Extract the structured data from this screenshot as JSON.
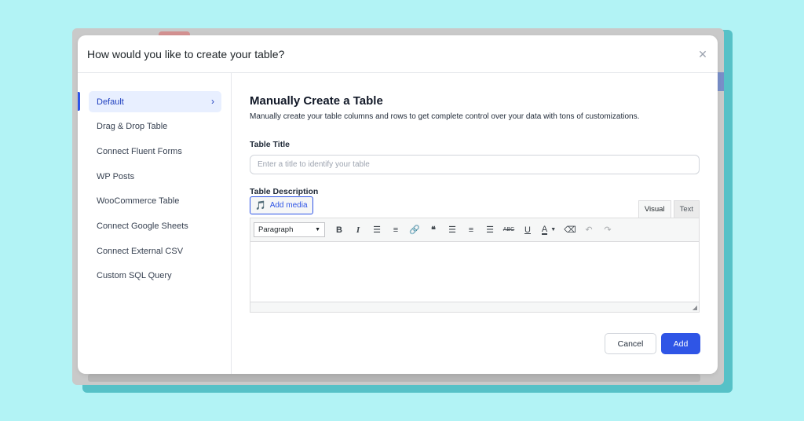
{
  "modal": {
    "title": "How would you like to create your table?",
    "close_icon": "close-icon"
  },
  "sidebar": {
    "items": [
      {
        "label": "Default",
        "active": true
      },
      {
        "label": "Drag & Drop Table"
      },
      {
        "label": "Connect Fluent Forms"
      },
      {
        "label": "WP Posts"
      },
      {
        "label": "WooCommerce Table"
      },
      {
        "label": "Connect Google Sheets"
      },
      {
        "label": "Connect External CSV"
      },
      {
        "label": "Custom SQL Query"
      }
    ]
  },
  "main": {
    "heading": "Manually Create a Table",
    "subtitle": "Manually create your table columns and rows to get complete control over your data with tons of customizations.",
    "title_field": {
      "label": "Table Title",
      "placeholder": "Enter a title to identify your table",
      "value": ""
    },
    "description_field": {
      "label": "Table Description"
    },
    "add_media_label": "Add media",
    "editor_tabs": {
      "visual": "Visual",
      "text": "Text"
    },
    "format_select": "Paragraph"
  },
  "actions": {
    "cancel": "Cancel",
    "add": "Add"
  },
  "colors": {
    "accent": "#2f55e6",
    "background": "#b2f3f5",
    "active_item_bg": "#e8efff"
  }
}
